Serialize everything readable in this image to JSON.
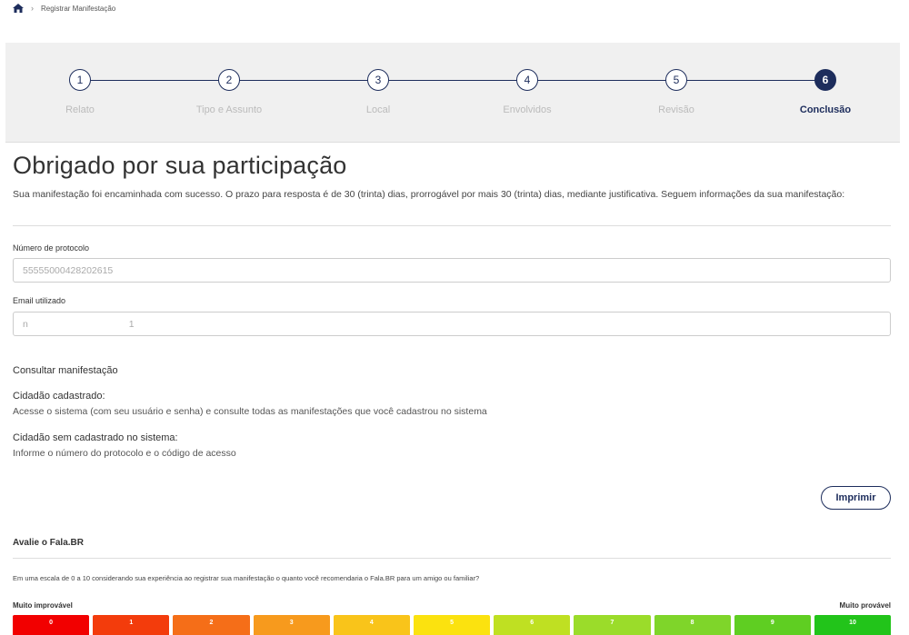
{
  "breadcrumb": {
    "current": "Registrar Manifestação"
  },
  "stepper": {
    "steps": [
      {
        "number": "1",
        "label": "Relato"
      },
      {
        "number": "2",
        "label": "Tipo e Assunto"
      },
      {
        "number": "3",
        "label": "Local"
      },
      {
        "number": "4",
        "label": "Envolvidos"
      },
      {
        "number": "5",
        "label": "Revisão"
      },
      {
        "number": "6",
        "label": "Conclusão"
      }
    ],
    "active_step": 6
  },
  "main": {
    "title": "Obrigado por sua participação",
    "intro": "Sua manifestação foi encaminhada com sucesso. O prazo para resposta é de 30 (trinta) dias, prorrogável por mais 30 (trinta) dias, mediante justificativa. Seguem informações da sua manifestação:",
    "protocol": {
      "label": "Número de protocolo",
      "value": "55555000428202615"
    },
    "email": {
      "label": "Email utilizado",
      "value": "n                                      1"
    }
  },
  "consult": {
    "title": "Consultar manifestação",
    "registered_title": "Cidadão cadastrado:",
    "registered_text": "Acesse o sistema (com seu usuário e senha) e consulte todas as manifestações que você cadastrou no sistema",
    "unregistered_title": "Cidadão sem cadastrado no sistema:",
    "unregistered_text": "Informe o número do protocolo e o código de acesso"
  },
  "actions": {
    "print_label": "Imprimir"
  },
  "rating": {
    "title": "Avalie o Fala.BR",
    "question": "Em uma escala de 0 a 10 considerando sua experiência ao registrar sua manifestação o quanto você recomendaria o Fala.BR para um amigo ou familiar?",
    "low_label": "Muito improvável",
    "high_label": "Muito provável",
    "scale": [
      {
        "value": "0",
        "color": "#f20000"
      },
      {
        "value": "1",
        "color": "#f33c0c"
      },
      {
        "value": "2",
        "color": "#f56e18"
      },
      {
        "value": "3",
        "color": "#f79a1d"
      },
      {
        "value": "4",
        "color": "#f9c41a"
      },
      {
        "value": "5",
        "color": "#fbe20f"
      },
      {
        "value": "6",
        "color": "#bfe022"
      },
      {
        "value": "7",
        "color": "#9bdc2a"
      },
      {
        "value": "8",
        "color": "#7fd52a"
      },
      {
        "value": "9",
        "color": "#5fce22"
      },
      {
        "value": "10",
        "color": "#22c41a"
      }
    ]
  },
  "colors": {
    "primary": "#1d2d5c",
    "stepper_bg": "#f0f0f0"
  }
}
